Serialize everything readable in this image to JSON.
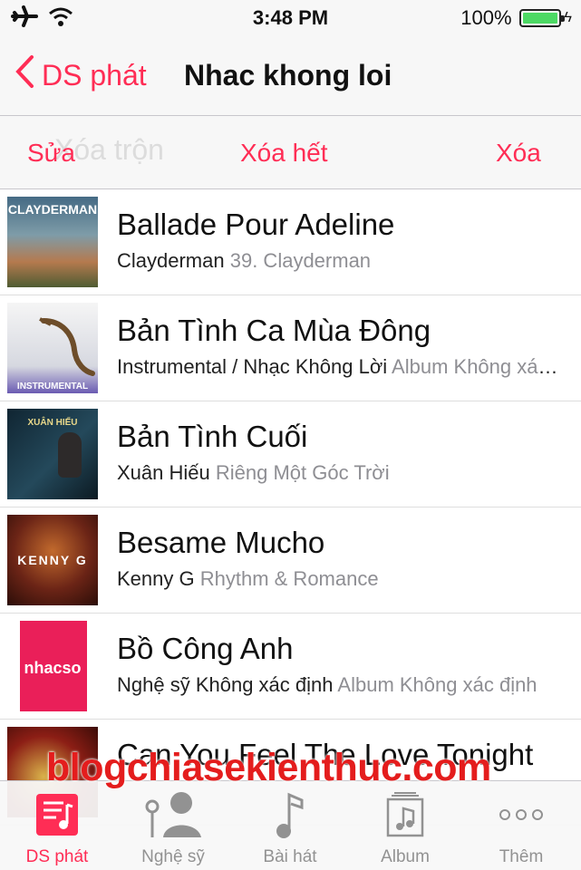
{
  "status_bar": {
    "time": "3:48 PM",
    "battery": "100%",
    "icons": [
      "airplane-icon",
      "wifi-icon",
      "battery-icon"
    ]
  },
  "nav": {
    "back_label": "DS phát",
    "title": "Nhac khong loi"
  },
  "toolbar": {
    "ghost_text": "Xóa trộn",
    "edit_label": "Sửa",
    "clear_label": "Xóa hết",
    "delete_label": "Xóa"
  },
  "songs": [
    {
      "title": "Ballade Pour Adeline",
      "artist": "Clayderman",
      "album": "39. Clayderman",
      "cover_text": "CLAYDERMAN"
    },
    {
      "title": "Bản Tình Ca Mùa Đông",
      "artist": "Instrumental / Nhạc Không Lời",
      "album": "Album Không xác định",
      "cover_text": "INSTRUMENTAL"
    },
    {
      "title": "Bản Tình Cuối",
      "artist": "Xuân Hiếu",
      "album": "Riêng Một Góc Trời",
      "cover_text": "XUÂN HIẾU"
    },
    {
      "title": "Besame Mucho",
      "artist": "Kenny G",
      "album": "Rhythm & Romance",
      "cover_text": "KENNY G"
    },
    {
      "title": "Bồ Công Anh",
      "artist": "Nghệ sỹ Không xác định",
      "album": "Album Không xác định",
      "cover_text": "nhacso"
    },
    {
      "title": "Can You Feel The Love Tonight",
      "artist": "",
      "album": "",
      "cover_text": ""
    }
  ],
  "watermark": "blogchiasekienthuc.com",
  "tabs": [
    {
      "label": "DS phát",
      "icon": "playlist-icon",
      "active": true
    },
    {
      "label": "Nghệ sỹ",
      "icon": "artist-icon",
      "active": false
    },
    {
      "label": "Bài hát",
      "icon": "music-note-icon",
      "active": false
    },
    {
      "label": "Album",
      "icon": "album-icon",
      "active": false
    },
    {
      "label": "Thêm",
      "icon": "more-icon",
      "active": false
    }
  ],
  "colors": {
    "accent": "#ff2d55",
    "battery": "#4cd964",
    "watermark": "#e41d1d"
  }
}
